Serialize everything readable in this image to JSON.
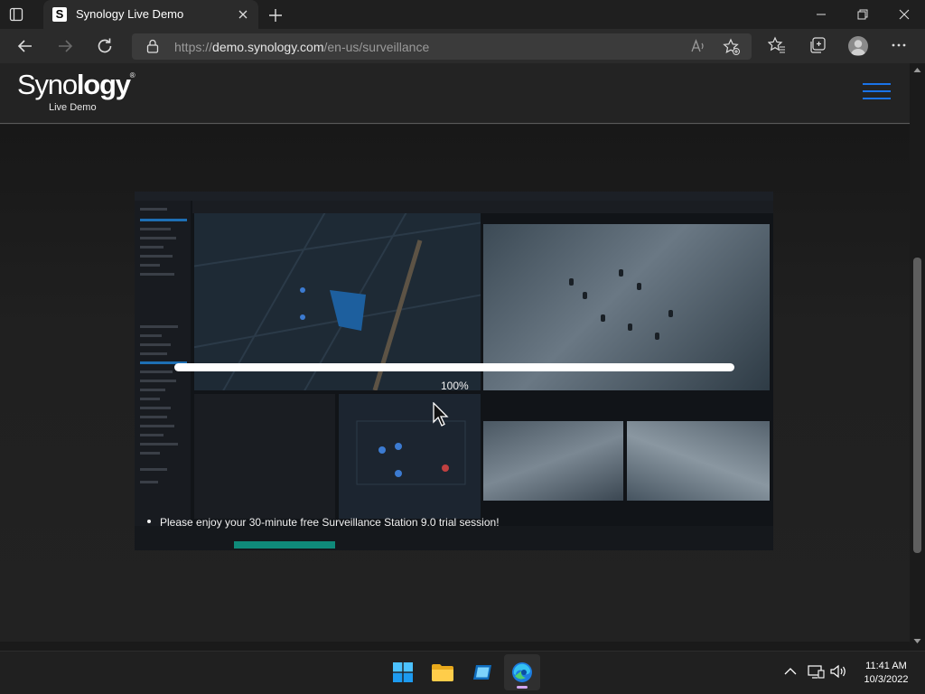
{
  "browser": {
    "tab_title": "Synology Live Demo",
    "tab_favicon_letter": "S",
    "url_prefix": "https://",
    "url_host": "demo.synology.com",
    "url_path": "/en-us/surveillance"
  },
  "site": {
    "logo_light": "Syno",
    "logo_bold": "logy",
    "logo_mark": "®",
    "subtitle": "Live Demo",
    "accent_color": "#1a73e8"
  },
  "loader": {
    "progress": 1.0,
    "progress_label": "100%",
    "notice": "Please enjoy your 30-minute free Surveillance Station 9.0 trial session!"
  },
  "taskbar": {
    "apps": [
      "windows-start-icon",
      "file-explorer-icon",
      "terminal-app-icon",
      "edge-browser-icon"
    ],
    "time": "11:41 AM",
    "date": "10/3/2022"
  }
}
